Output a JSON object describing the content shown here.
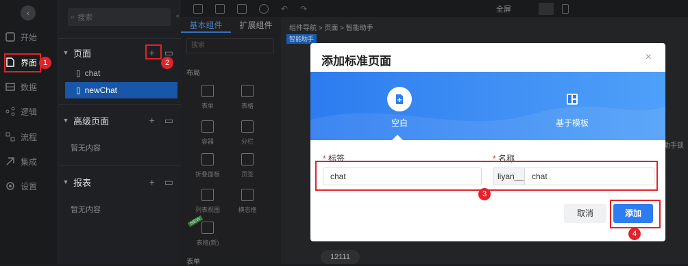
{
  "nav": {
    "items": [
      {
        "label": "开始",
        "icon": "home-icon"
      },
      {
        "label": "界面",
        "icon": "page-icon"
      },
      {
        "label": "数据",
        "icon": "table-icon"
      },
      {
        "label": "逻辑",
        "icon": "logic-icon"
      },
      {
        "label": "流程",
        "icon": "flow-icon"
      },
      {
        "label": "集成",
        "icon": "integration-icon"
      },
      {
        "label": "设置",
        "icon": "gear-icon"
      }
    ]
  },
  "tree": {
    "search_placeholder": "搜索",
    "pages_title": "页面",
    "pages": [
      "chat",
      "newChat"
    ],
    "advanced_title": "高级页面",
    "advanced_empty": "暂无内容",
    "reports_title": "报表",
    "reports_empty": "暂无内容"
  },
  "toolbar": {
    "fullscreen": "全屏"
  },
  "components": {
    "tabs": [
      "基本组件",
      "扩展组件"
    ],
    "search_placeholder": "搜索",
    "group_layout": "布局",
    "items": [
      "表单",
      "表格",
      "容器",
      "分栏",
      "折叠面板",
      "页签",
      "列表视图",
      "横态框",
      "表格(新)"
    ],
    "group_bottom": "表单",
    "new_badge": "NEW"
  },
  "canvas": {
    "breadcrumb": "组件导航 > 页面 > 智能助手",
    "tag": "智能助手",
    "side_text": "助手锁",
    "value": "12111"
  },
  "dialog": {
    "title": "添加标准页面",
    "close": "×",
    "options": [
      "空白",
      "基于模板"
    ],
    "label_field": "标签",
    "name_field": "名称",
    "label_value": "chat",
    "name_prefix": "liyan__",
    "name_value": "chat",
    "required_mark": "*",
    "cancel": "取消",
    "submit": "添加"
  },
  "annotations": [
    "1",
    "2",
    "3",
    "4"
  ],
  "colors": {
    "accent": "#2d7cf0",
    "annotation": "#e3222b",
    "selected": "#1756a8"
  }
}
